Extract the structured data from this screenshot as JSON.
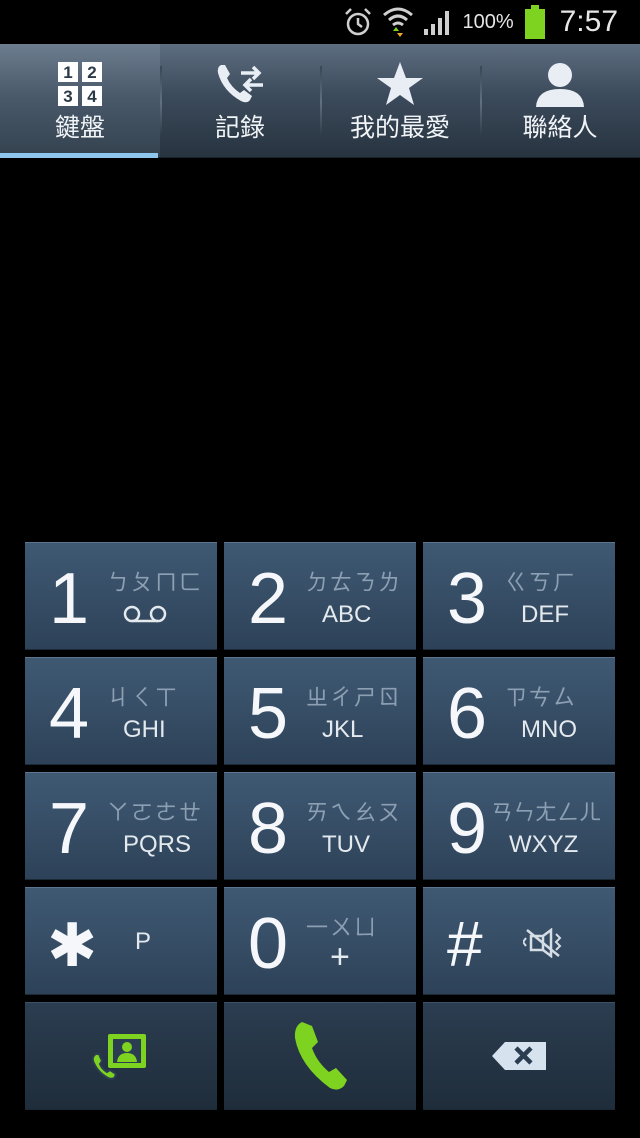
{
  "status_bar": {
    "battery_percent": "100%",
    "time": "7:57",
    "icons": [
      "alarm-icon",
      "wifi-icon",
      "signal-icon",
      "battery-icon"
    ],
    "battery_color": "#7ed321"
  },
  "tabs": [
    {
      "label": "鍵盤",
      "icon": "keypad-icon",
      "active": true
    },
    {
      "label": "記錄",
      "icon": "call-log-icon",
      "active": false
    },
    {
      "label": "我的最愛",
      "icon": "star-icon",
      "active": false
    },
    {
      "label": "聯絡人",
      "icon": "contact-icon",
      "active": false
    }
  ],
  "keypad": {
    "keys": [
      {
        "digit": "1",
        "zhuyin": "ㄅㄆㄇㄈ",
        "letters": "",
        "icon": "voicemail-icon"
      },
      {
        "digit": "2",
        "zhuyin": "ㄉㄊㄋㄌ",
        "letters": "ABC"
      },
      {
        "digit": "3",
        "zhuyin": "ㄍㄎㄏ",
        "letters": "DEF"
      },
      {
        "digit": "4",
        "zhuyin": "ㄐㄑㄒ",
        "letters": "GHI"
      },
      {
        "digit": "5",
        "zhuyin": "ㄓㄔㄕㄖ",
        "letters": "JKL"
      },
      {
        "digit": "6",
        "zhuyin": "ㄗㄘㄙ",
        "letters": "MNO"
      },
      {
        "digit": "7",
        "zhuyin": "ㄚㄛㄜㄝ",
        "letters": "PQRS"
      },
      {
        "digit": "8",
        "zhuyin": "ㄞㄟㄠㄡ",
        "letters": "TUV"
      },
      {
        "digit": "9",
        "zhuyin": "ㄢㄣㄤㄥㄦ",
        "letters": "WXYZ"
      },
      {
        "digit": "✱",
        "zhuyin": "",
        "letters": "P"
      },
      {
        "digit": "0",
        "zhuyin": "一ㄨㄩ",
        "letters": "+"
      },
      {
        "digit": "#",
        "zhuyin": "",
        "letters": "",
        "icon": "mute-icon"
      }
    ],
    "actions": [
      {
        "icon": "add-contact-icon",
        "color": "#7ed321"
      },
      {
        "icon": "call-icon",
        "color": "#7ed321"
      },
      {
        "icon": "backspace-icon",
        "color": "#d6e2ee"
      }
    ]
  }
}
